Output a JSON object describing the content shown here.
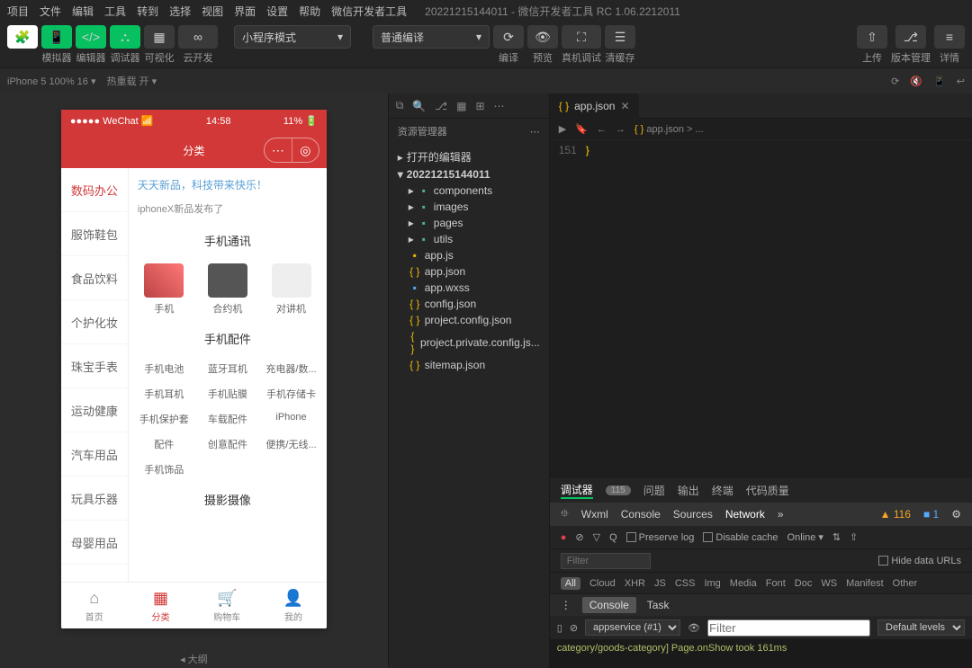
{
  "menubar": {
    "items": [
      "项目",
      "文件",
      "编辑",
      "工具",
      "转到",
      "选择",
      "视图",
      "界面",
      "设置",
      "帮助",
      "微信开发者工具"
    ],
    "title": "20221215144011 - 微信开发者工具 RC 1.06.2212011"
  },
  "toolbar": {
    "groups": [
      {
        "label": "模拟器",
        "icon": "▭"
      },
      {
        "label": "编辑器",
        "icon": "</>"
      },
      {
        "label": "调试器",
        "icon": "⛬"
      },
      {
        "label": "可视化",
        "icon": "▦"
      },
      {
        "label": "云开发",
        "icon": "∞"
      }
    ],
    "mode": "小程序模式",
    "compile": "普通编译",
    "actions": [
      {
        "label": "编译",
        "icon": "⟳"
      },
      {
        "label": "预览",
        "icon": "👁"
      },
      {
        "label": "真机调试",
        "icon": "⛶"
      },
      {
        "label": "清缓存",
        "icon": "☰"
      }
    ],
    "right": [
      {
        "label": "上传",
        "icon": "⇧"
      },
      {
        "label": "版本管理",
        "icon": "⎇"
      },
      {
        "label": "详情",
        "icon": "≡"
      }
    ]
  },
  "secondbar": {
    "device": "iPhone 5 100% 16",
    "reload": "热重载 开"
  },
  "phone": {
    "carrier": "WeChat",
    "time": "14:58",
    "battery": "11%",
    "title": "分类",
    "sideItems": [
      "数码办公",
      "服饰鞋包",
      "食品饮料",
      "个护化妆",
      "珠宝手表",
      "运动健康",
      "汽车用品",
      "玩具乐器",
      "母婴用品"
    ],
    "banner1": "天天新品，科技带来快乐！",
    "banner2": "iphoneX新品发布了",
    "sec1": {
      "title": "手机通讯",
      "items": [
        "手机",
        "合约机",
        "对讲机"
      ]
    },
    "sec2": {
      "title": "手机配件",
      "items": [
        "手机电池",
        "蓝牙耳机",
        "充电器/数...",
        "手机耳机",
        "手机贴膜",
        "手机存储卡",
        "手机保护套",
        "车载配件",
        "iPhone",
        "配件",
        "创意配件",
        "便携/无线...",
        " 手机饰品",
        "",
        ""
      ]
    },
    "sec3": {
      "title": "摄影摄像"
    },
    "tabs": [
      {
        "label": "首页",
        "icon": "⌂"
      },
      {
        "label": "分类",
        "icon": "▦"
      },
      {
        "label": "购物车",
        "icon": "🛒"
      },
      {
        "label": "我的",
        "icon": "👤"
      }
    ]
  },
  "explorer": {
    "title": "资源管理器",
    "openEditors": "打开的编辑器",
    "project": "20221215144011",
    "folders": [
      "components",
      "images",
      "pages",
      "utils"
    ],
    "files": [
      "app.js",
      "app.json",
      "app.wxss",
      "config.json",
      "project.config.json",
      "project.private.config.js...",
      "sitemap.json"
    ]
  },
  "editor": {
    "tab": "app.json",
    "line": "151",
    "code": "}",
    "breadcrumb": "app.json > ..."
  },
  "devtools": {
    "tabs": [
      "调试器",
      "问题",
      "输出",
      "终端",
      "代码质量"
    ],
    "badge": "115",
    "subtabs": [
      "Wxml",
      "Console",
      "Sources",
      "Network"
    ],
    "warn": "▲ 116",
    "info": "■ 1",
    "preserve": "Preserve log",
    "disable": "Disable cache",
    "online": "Online",
    "filterPh": "Filter",
    "hideUrls": "Hide data URLs",
    "types": [
      "All",
      "Cloud",
      "XHR",
      "JS",
      "CSS",
      "Img",
      "Media",
      "Font",
      "Doc",
      "WS",
      "Manifest",
      "Other"
    ],
    "consoleTabs": [
      "Console",
      "Task"
    ],
    "ctx": "appservice (#1)",
    "levels": "Default levels",
    "msg": "category/goods-category] Page.onShow took 161ms"
  },
  "footer": "大纲"
}
